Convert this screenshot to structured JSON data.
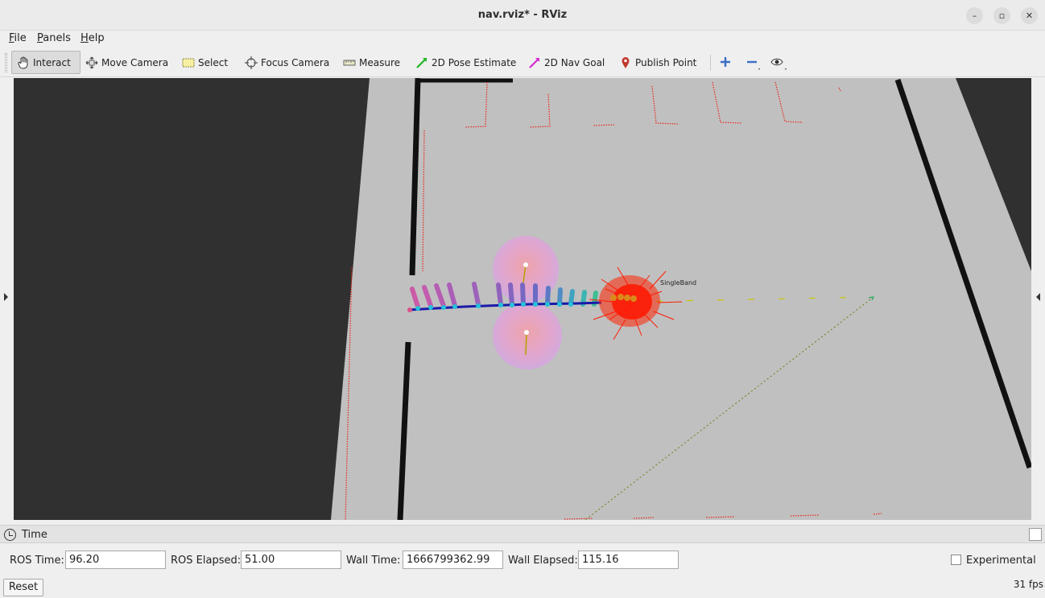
{
  "window": {
    "title": "nav.rviz* - RViz"
  },
  "menu": [
    {
      "pre": "",
      "u": "F",
      "post": "ile"
    },
    {
      "pre": "",
      "u": "P",
      "post": "anels"
    },
    {
      "pre": "",
      "u": "H",
      "post": "elp"
    }
  ],
  "toolbar": {
    "interact": "Interact",
    "move_camera": "Move Camera",
    "select": "Select",
    "focus_camera": "Focus Camera",
    "measure": "Measure",
    "pose_estimate": "2D Pose Estimate",
    "nav_goal": "2D Nav Goal",
    "publish_point": "Publish Point",
    "active_tool": "Interact"
  },
  "viewport": {
    "band_label": "SingleBand"
  },
  "time_panel": {
    "title": "Time",
    "ros_time_label": "ROS Time:",
    "ros_time_value": "96.20",
    "ros_elapsed_label": "ROS Elapsed:",
    "ros_elapsed_value": "51.00",
    "wall_time_label": "Wall Time:",
    "wall_time_value": "1666799362.99",
    "wall_elapsed_label": "Wall Elapsed:",
    "wall_elapsed_value": "115.16",
    "experimental_label": "Experimental",
    "experimental_checked": false,
    "reset_label": "Reset",
    "fps": "31 fps"
  },
  "colors": {
    "background": "#303030",
    "floor": "#c0c0c0",
    "laser": "#e8271b",
    "path": "#1a1aa8",
    "footprint": "#e8a0d8"
  }
}
